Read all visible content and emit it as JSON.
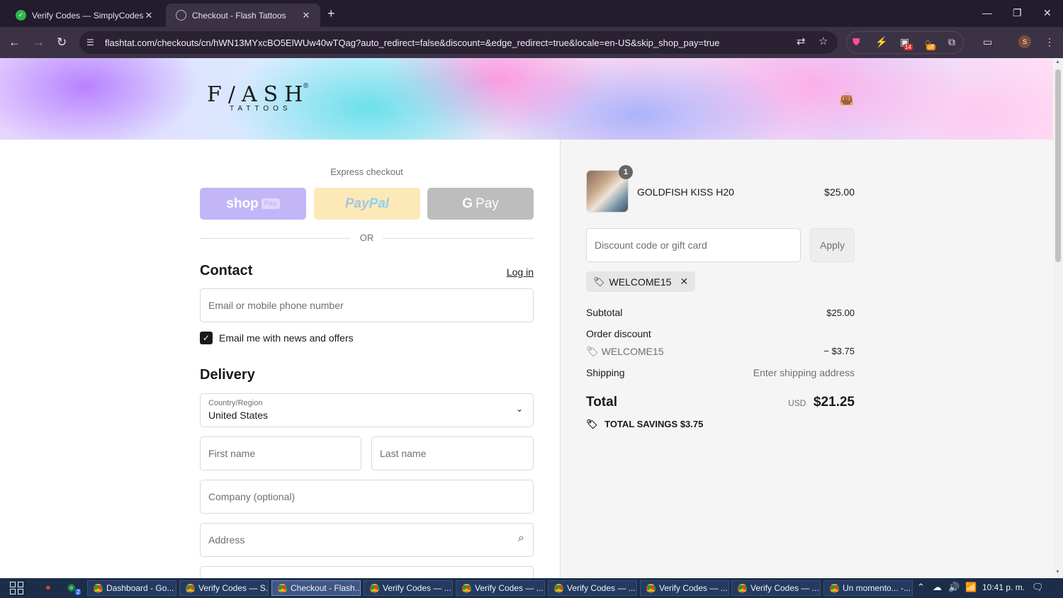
{
  "browser": {
    "tabs": [
      {
        "title": "Verify Codes — SimplyCodes",
        "close": "✕"
      },
      {
        "title": "Checkout - Flash Tattoos",
        "close": "✕"
      }
    ],
    "new_tab": "+",
    "window_controls": {
      "minimize": "—",
      "restore": "❐",
      "close": "✕"
    },
    "url": "flashtat.com/checkouts/cn/hWN13MYxcBO5ElWUw40wTQag?auto_redirect=false&discount=&edge_redirect=true&locale=en-US&skip_shop_pay=true",
    "extensions": {
      "counter_badge": "14",
      "off_badge": "off"
    },
    "profile_initial": "S"
  },
  "header": {
    "logo_main": "F/ASH",
    "logo_sub": "TATTOOS",
    "logo_mark": "®"
  },
  "checkout": {
    "express_label": "Express checkout",
    "shop_pay": {
      "text": "shop",
      "tag": "Pay"
    },
    "paypal": {
      "pay": "Pay",
      "pal": "Pal"
    },
    "gpay": {
      "g": "G",
      "text": "Pay"
    },
    "or": "OR",
    "contact_title": "Contact",
    "login": "Log in",
    "email_placeholder": "Email or mobile phone number",
    "news_checkbox": {
      "checked": true,
      "label": "Email me with news and offers"
    },
    "delivery_title": "Delivery",
    "country": {
      "label": "Country/Region",
      "value": "United States"
    },
    "first_name_placeholder": "First name",
    "last_name_placeholder": "Last name",
    "company_placeholder": "Company (optional)",
    "address_placeholder": "Address"
  },
  "summary": {
    "item": {
      "quantity": "1",
      "name": "GOLDFISH KISS H20",
      "price": "$25.00"
    },
    "discount_placeholder": "Discount code or gift card",
    "apply": "Apply",
    "applied_code": "WELCOME15",
    "subtotal_label": "Subtotal",
    "subtotal_value": "$25.00",
    "order_discount_label": "Order discount",
    "discount_code": "WELCOME15",
    "discount_value": "− $3.75",
    "shipping_label": "Shipping",
    "shipping_value": "Enter shipping address",
    "total_label": "Total",
    "total_currency": "USD",
    "total_value": "$21.25",
    "savings_label": "TOTAL SAVINGS",
    "savings_value": "$3.75"
  },
  "taskbar": {
    "apps": [
      {
        "label": "Dashboard - Go..."
      },
      {
        "label": "Verify Codes — S..."
      },
      {
        "label": "Checkout - Flash..."
      },
      {
        "label": "Verify Codes — ..."
      },
      {
        "label": "Verify Codes — ..."
      },
      {
        "label": "Verify Codes — ..."
      },
      {
        "label": "Verify Codes — ..."
      },
      {
        "label": "Verify Codes — ..."
      },
      {
        "label": "Un momento... -..."
      }
    ],
    "whatsapp_badge": "2",
    "clock": "10:41 p. m."
  },
  "colors": {
    "chrome_dark": "#231b2e",
    "toolbar": "#3b3345",
    "shop_pay": "#c3b6f7",
    "paypal": "#fde9b8",
    "gpay": "#bdbdbd",
    "taskbar": "#1c2d4a"
  }
}
